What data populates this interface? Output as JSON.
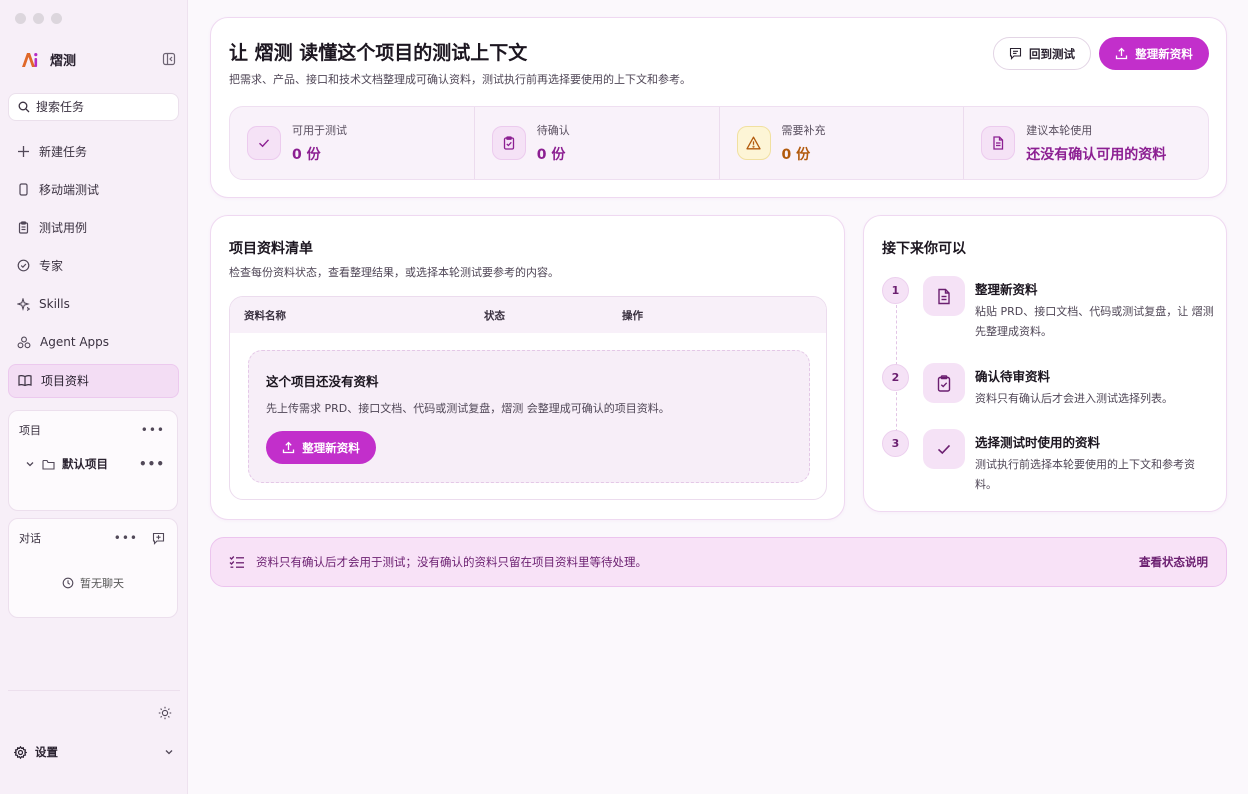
{
  "app": {
    "name": "熠测"
  },
  "sidebar": {
    "search_placeholder": "搜索任务",
    "items": [
      {
        "label": "新建任务",
        "icon": "plus-icon"
      },
      {
        "label": "移动端测试",
        "icon": "phone-icon"
      },
      {
        "label": "测试用例",
        "icon": "clipboard-icon"
      },
      {
        "label": "专家",
        "icon": "check-circle-icon"
      },
      {
        "label": "Skills",
        "icon": "sparkle-icon"
      },
      {
        "label": "Agent Apps",
        "icon": "apps-icon"
      },
      {
        "label": "项目资料",
        "icon": "book-icon",
        "active": true
      }
    ],
    "projects": {
      "header": "项目",
      "default_project": "默认项目"
    },
    "chats": {
      "header": "对话",
      "empty": "暂无聊天"
    },
    "settings_label": "设置"
  },
  "hero": {
    "title": "让 熠测 读懂这个项目的测试上下文",
    "subtitle": "把需求、产品、接口和技术文档整理成可确认资料，测试执行前再选择要使用的上下文和参考。",
    "back_button": "回到测试",
    "organize_button": "整理新资料",
    "stats": [
      {
        "label": "可用于测试",
        "value": "0 份",
        "icon": "check-icon"
      },
      {
        "label": "待确认",
        "value": "0 份",
        "icon": "clipboard-check-icon"
      },
      {
        "label": "需要补充",
        "value": "0 份",
        "icon": "warning-icon",
        "tone": "warn"
      },
      {
        "label": "建议本轮使用",
        "value": "还没有确认可用的资料",
        "icon": "document-icon"
      }
    ]
  },
  "list": {
    "title": "项目资料清单",
    "subtitle": "检查每份资料状态，查看整理结果，或选择本轮测试要参考的内容。",
    "columns": [
      "资料名称",
      "状态",
      "操作"
    ],
    "empty_title": "这个项目还没有资料",
    "empty_desc": "先上传需求 PRD、接口文档、代码或测试复盘，熠测 会整理成可确认的项目资料。",
    "empty_button": "整理新资料"
  },
  "next": {
    "title": "接下来你可以",
    "steps": [
      {
        "num": "1",
        "title": "整理新资料",
        "desc": "粘贴 PRD、接口文档、代码或测试复盘，让 熠测 先整理成资料。"
      },
      {
        "num": "2",
        "title": "确认待审资料",
        "desc": "资料只有确认后才会进入测试选择列表。"
      },
      {
        "num": "3",
        "title": "选择测试时使用的资料",
        "desc": "测试执行前选择本轮要使用的上下文和参考资料。"
      }
    ]
  },
  "banner": {
    "text": "资料只有确认后才会用于测试；没有确认的资料只留在项目资料里等待处理。",
    "link": "查看状态说明"
  },
  "colors": {
    "accent": "#c22fcb",
    "accent_dark": "#8c1f92",
    "warn": "#b25a0c"
  }
}
